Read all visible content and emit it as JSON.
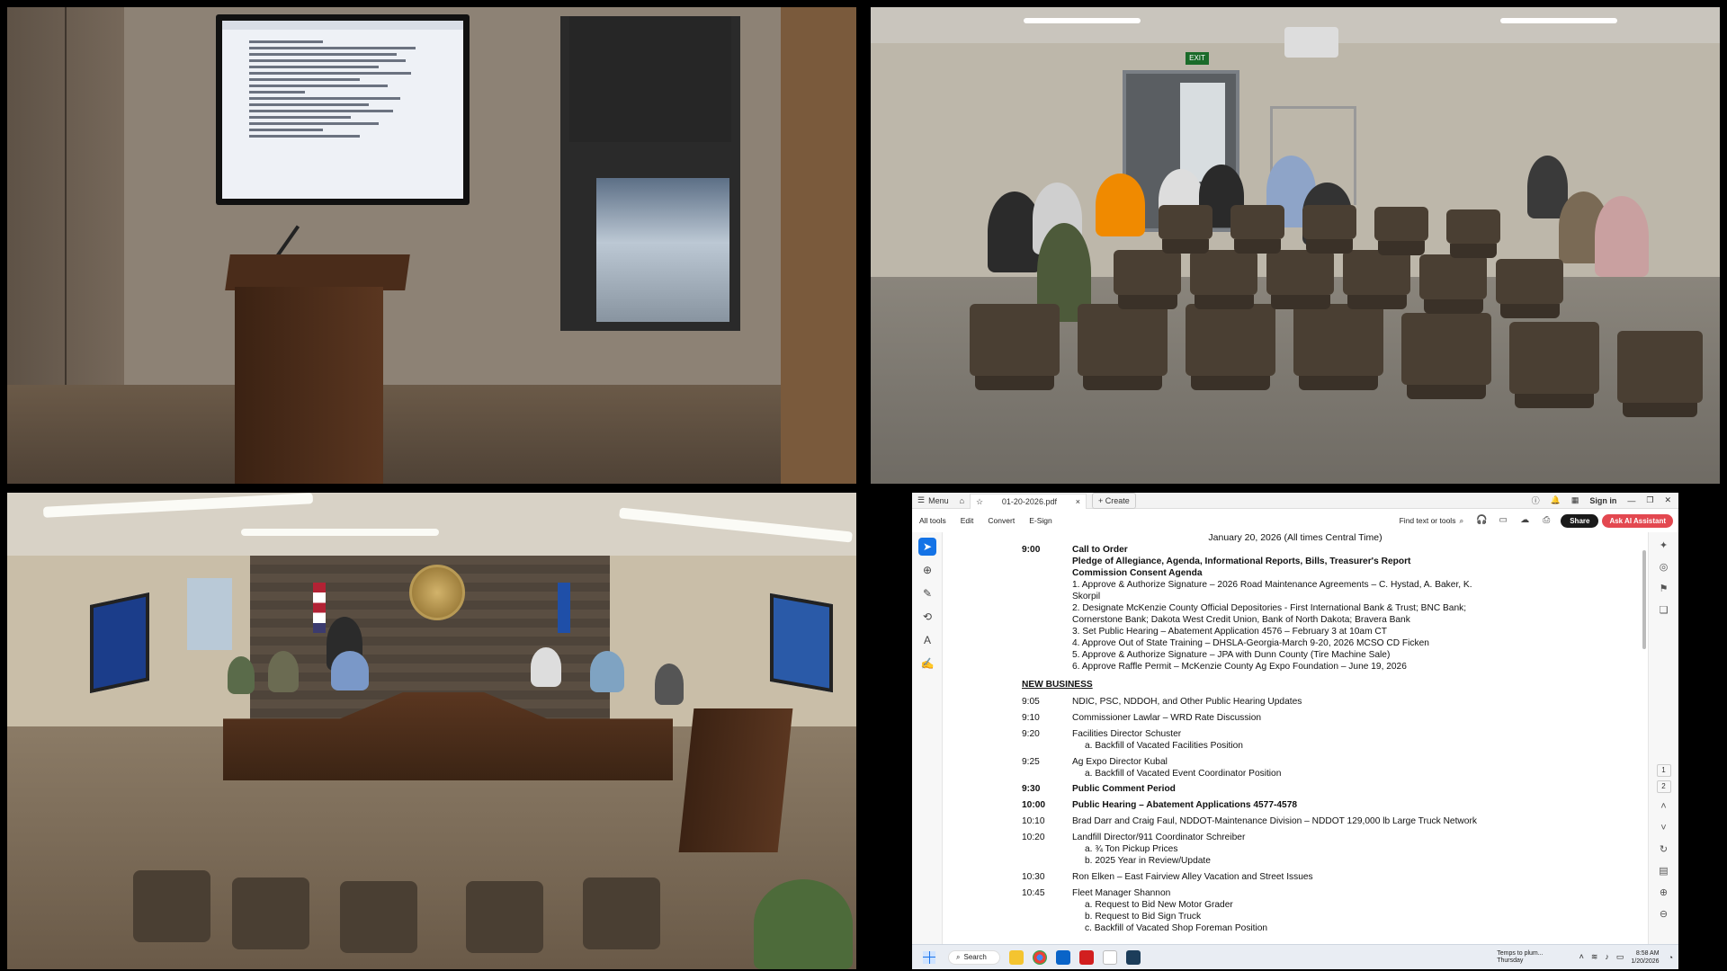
{
  "acrobat": {
    "menu_label": "Menu",
    "tab_title": "01-20-2026.pdf",
    "tab_close": "×",
    "new_tab": "+  Create",
    "sign_in": "Sign in",
    "toolbar": {
      "all_tools": "All tools",
      "edit": "Edit",
      "convert": "Convert",
      "esign": "E-Sign",
      "find": "Find text or tools",
      "share": "Share",
      "ai": "Ask AI Assistant"
    },
    "page_numbers": [
      "1",
      "2"
    ]
  },
  "document": {
    "date_line": "January 20, 2026 (All times Central Time)",
    "call_to_order": {
      "time": "9:00",
      "title": "Call to Order"
    },
    "pledge_line": "Pledge of Allegiance, Agenda, Informational Reports, Bills, Treasurer's Report",
    "consent_title": "Commission Consent Agenda",
    "consent_items": [
      "1.   Approve & Authorize Signature – 2026 Road Maintenance Agreements – C. Hystad, A. Baker, K.",
      "      Skorpil",
      "2.   Designate McKenzie County Official Depositories - First International Bank & Trust; BNC Bank;",
      "      Cornerstone Bank; Dakota West Credit Union, Bank of North Dakota; Bravera Bank",
      "3.   Set Public Hearing – Abatement Application 4576 – February 3 at 10am CT",
      "4.   Approve Out of State Training – DHSLA-Georgia-March 9-20, 2026 MCSO CD Ficken",
      "5.   Approve & Authorize Signature – JPA with Dunn County (Tire Machine Sale)",
      "6.   Approve Raffle Permit – McKenzie County Ag Expo Foundation – June 19, 2026"
    ],
    "new_business_heading": "NEW BUSINESS",
    "items": [
      {
        "time": "9:05",
        "text": "NDIC, PSC, NDDOH, and Other Public Hearing Updates",
        "bold": false,
        "subs": []
      },
      {
        "time": "9:10",
        "text": "Commissioner Lawlar – WRD Rate Discussion",
        "bold": false,
        "subs": []
      },
      {
        "time": "9:20",
        "text": "Facilities Director Schuster",
        "bold": false,
        "subs": [
          "a.   Backfill of Vacated Facilities Position"
        ]
      },
      {
        "time": "9:25",
        "text": "Ag Expo Director Kubal",
        "bold": false,
        "subs": [
          "a.   Backfill of Vacated Event Coordinator Position"
        ]
      },
      {
        "time": "9:30",
        "text": "Public Comment Period",
        "bold": true,
        "subs": []
      },
      {
        "time": "10:00",
        "text": "Public Hearing – Abatement Applications 4577-4578",
        "bold": true,
        "subs": []
      },
      {
        "time": "10:10",
        "text": "Brad Darr and Craig Faul, NDDOT-Maintenance Division – NDDOT 129,000 lb Large Truck Network",
        "bold": false,
        "subs": []
      },
      {
        "time": "10:20",
        "text": "Landfill Director/911 Coordinator Schreiber",
        "bold": false,
        "subs": [
          "a.   ¾ Ton Pickup Prices",
          "b.   2025 Year in Review/Update"
        ]
      },
      {
        "time": "10:30",
        "text": "Ron Elken – East Fairview Alley Vacation and Street Issues",
        "bold": false,
        "subs": []
      },
      {
        "time": "10:45",
        "text": "Fleet Manager Shannon",
        "bold": false,
        "subs": [
          "a.   Request to Bid New Motor Grader",
          "b.   Request to Bid Sign Truck",
          "c.   Backfill of Vacated Shop Foreman Position"
        ]
      }
    ]
  },
  "taskbar": {
    "search_label": "Search",
    "weather_line1": "Temps to plum...",
    "weather_line2": "Thursday",
    "time": "8:58 AM",
    "date": "1/20/2026"
  },
  "camera_tr": {
    "exit_sign": "EXIT"
  }
}
